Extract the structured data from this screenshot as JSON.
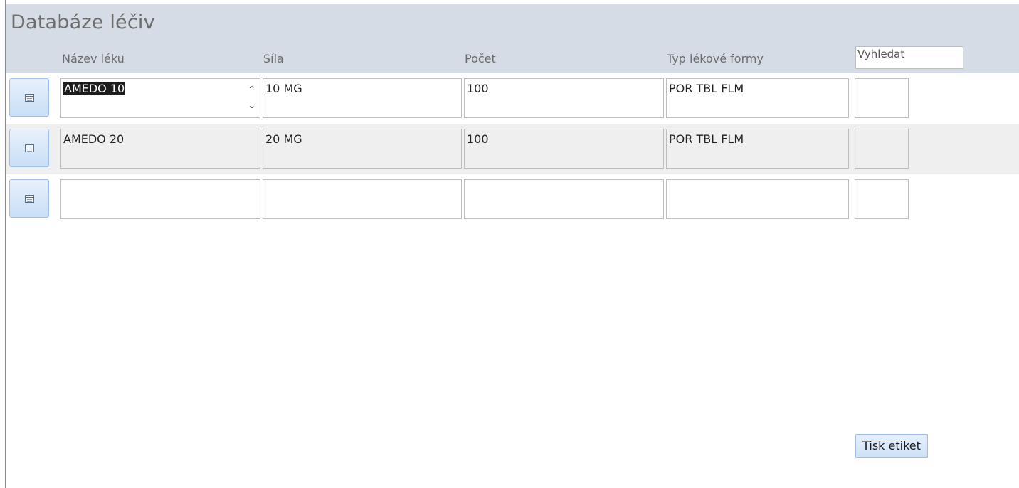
{
  "form": {
    "title": "Databáze léčiv",
    "columns": {
      "nazev": "Název léku",
      "sila": "Síla",
      "pocet": "Počet",
      "typ": "Typ lékové formy"
    },
    "search_value": "Vyhledat"
  },
  "rows": [
    {
      "nazev": "AMEDO 10",
      "sila": "10 MG",
      "pocet": "100",
      "typ": "POR TBL FLM",
      "extra": ""
    },
    {
      "nazev": "AMEDO 20",
      "sila": "20 MG",
      "pocet": "100",
      "typ": "POR TBL FLM",
      "extra": ""
    },
    {
      "nazev": "",
      "sila": "",
      "pocet": "",
      "typ": "",
      "extra": ""
    }
  ],
  "icons": {
    "record_selector": "form-icon",
    "scroll": [
      "chevron-up-icon",
      "chevron-down-icon"
    ]
  },
  "buttons": {
    "print_labels": "Tisk etiket"
  },
  "colors": {
    "header_bg": "#d6dce5",
    "alt_row_bg": "#efefef",
    "button_bg": "#cfe1f7"
  }
}
